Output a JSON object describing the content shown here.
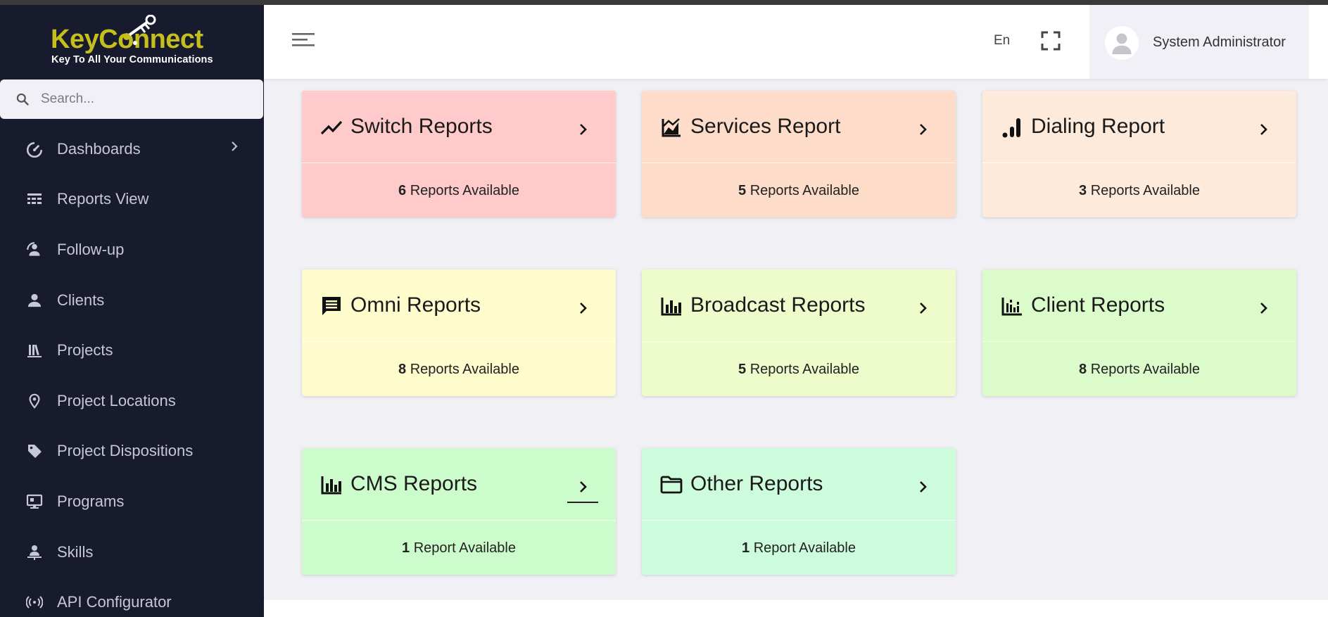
{
  "app": {
    "logo_title": "KeyConnect",
    "logo_subtitle": "Key To All Your Communications"
  },
  "search": {
    "placeholder": "Search..."
  },
  "sidebar": {
    "items": [
      {
        "label": "Dashboards",
        "icon": "gauge-icon",
        "has_chevron": true
      },
      {
        "label": "Reports View",
        "icon": "table-icon"
      },
      {
        "label": "Follow-up",
        "icon": "follow-up-icon"
      },
      {
        "label": "Clients",
        "icon": "person-icon"
      },
      {
        "label": "Projects",
        "icon": "library-icon"
      },
      {
        "label": "Project Locations",
        "icon": "location-pin-icon"
      },
      {
        "label": "Project Dispositions",
        "icon": "tag-icon"
      },
      {
        "label": "Programs",
        "icon": "monitor-icon"
      },
      {
        "label": "Skills",
        "icon": "skills-icon"
      },
      {
        "label": "API Configurator",
        "icon": "antenna-icon"
      }
    ]
  },
  "header": {
    "language": "En",
    "user_name": "System Administrator"
  },
  "cards": [
    {
      "title": "Switch Reports",
      "count": "6",
      "suffix": " Reports Available",
      "bg": "#fecaca",
      "icon": "trending-up-icon"
    },
    {
      "title": "Services Report",
      "count": "5",
      "suffix": " Reports Available",
      "bg": "#fedcca",
      "icon": "area-chart-icon"
    },
    {
      "title": "Dialing Report",
      "count": "3",
      "suffix": " Reports Available",
      "bg": "#feeadb",
      "icon": "signal-bars-icon"
    },
    {
      "title": "Omni Reports",
      "count": "8",
      "suffix": " Reports Available",
      "bg": "#fefccc",
      "icon": "message-icon"
    },
    {
      "title": "Broadcast Reports",
      "count": "5",
      "suffix": " Reports Available",
      "bg": "#eefccc",
      "icon": "bar-chart-icon"
    },
    {
      "title": "Client Reports",
      "count": "8",
      "suffix": " Reports Available",
      "bg": "#dbfcca",
      "icon": "bar-chart-outline-icon"
    },
    {
      "title": "CMS Reports",
      "count": "1",
      "suffix": " Report Available",
      "bg": "#ccfccb",
      "icon": "bar-chart-icon"
    },
    {
      "title": "Other Reports",
      "count": "1",
      "suffix": " Report Available",
      "bg": "#ccfcdc",
      "icon": "folder-icon"
    }
  ]
}
